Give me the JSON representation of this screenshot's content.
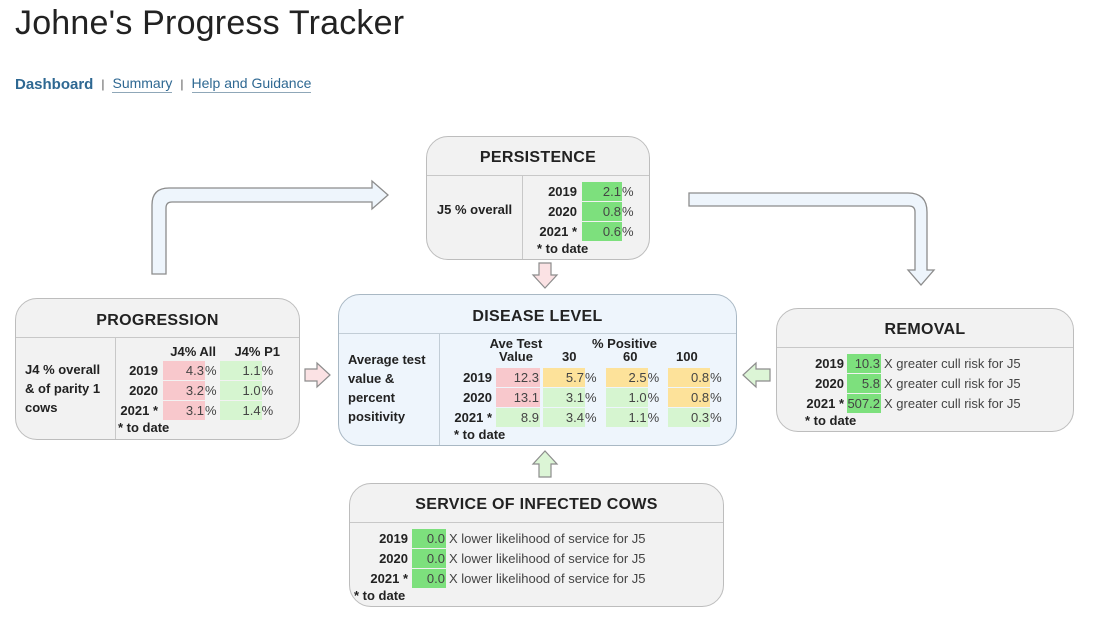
{
  "page": {
    "title": "Johne's Progress Tracker"
  },
  "nav": {
    "active": "Dashboard",
    "separator": "|",
    "links": [
      "Summary",
      "Help and Guidance"
    ]
  },
  "colors": {
    "red": "#f8c8cc",
    "amber": "#fde29a",
    "green_light": "#d6f5d0",
    "green_bright": "#7de07d",
    "link": "#2e6892"
  },
  "note": "* to date",
  "persistence": {
    "title": "PERSISTENCE",
    "label": "J5 % overall",
    "rows": [
      {
        "year": "2019",
        "value": "2.1",
        "unit": "%",
        "status": "green_bright"
      },
      {
        "year": "2020",
        "value": "0.8",
        "unit": "%",
        "status": "green_bright"
      },
      {
        "year": "2021 *",
        "value": "0.6",
        "unit": "%",
        "status": "green_bright"
      }
    ]
  },
  "progression": {
    "title": "PROGRESSION",
    "label_lines": [
      "J4 % overall",
      "& of parity 1",
      "cows"
    ],
    "columns": [
      "J4% All",
      "J4% P1"
    ],
    "rows": [
      {
        "year": "2019",
        "all": "4.3",
        "p1": "1.1",
        "all_status": "red",
        "p1_status": "green_light"
      },
      {
        "year": "2020",
        "all": "3.2",
        "p1": "1.0",
        "all_status": "red",
        "p1_status": "green_light"
      },
      {
        "year": "2021 *",
        "all": "3.1",
        "p1": "1.4",
        "all_status": "red",
        "p1_status": "green_light"
      }
    ],
    "unit": "%"
  },
  "disease_level": {
    "title": "DISEASE LEVEL",
    "label_lines": [
      "Average test",
      "value &",
      "percent",
      "positivity"
    ],
    "col_ave_line1": "Ave Test",
    "col_ave_line2": "Value",
    "col_group": "% Positive",
    "col_30": "30",
    "col_60": "60",
    "col_100": "100",
    "rows": [
      {
        "year": "2019",
        "ave": "12.3",
        "p30": "5.7",
        "p60": "2.5",
        "p100": "0.8",
        "s_ave": "red",
        "s30": "amber",
        "s60": "amber",
        "s100": "amber"
      },
      {
        "year": "2020",
        "ave": "13.1",
        "p30": "3.1",
        "p60": "1.0",
        "p100": "0.8",
        "s_ave": "red",
        "s30": "green_light",
        "s60": "green_light",
        "s100": "amber"
      },
      {
        "year": "2021 *",
        "ave": "8.9",
        "p30": "3.4",
        "p60": "1.1",
        "p100": "0.3",
        "s_ave": "green_light",
        "s30": "green_light",
        "s60": "green_light",
        "s100": "green_light"
      }
    ],
    "unit": "%"
  },
  "removal": {
    "title": "REMOVAL",
    "suffix": "X greater cull risk for J5",
    "rows": [
      {
        "year": "2019",
        "value": "10.3",
        "status": "green_bright"
      },
      {
        "year": "2020",
        "value": "5.8",
        "status": "green_bright"
      },
      {
        "year": "2021 *",
        "value": "507.2",
        "status": "green_bright"
      }
    ]
  },
  "service": {
    "title": "SERVICE OF INFECTED COWS",
    "suffix": "X lower likelihood of service for J5",
    "rows": [
      {
        "year": "2019",
        "value": "0.0",
        "status": "green_bright"
      },
      {
        "year": "2020",
        "value": "0.0",
        "status": "green_bright"
      },
      {
        "year": "2021 *",
        "value": "0.0",
        "status": "green_bright"
      }
    ]
  }
}
